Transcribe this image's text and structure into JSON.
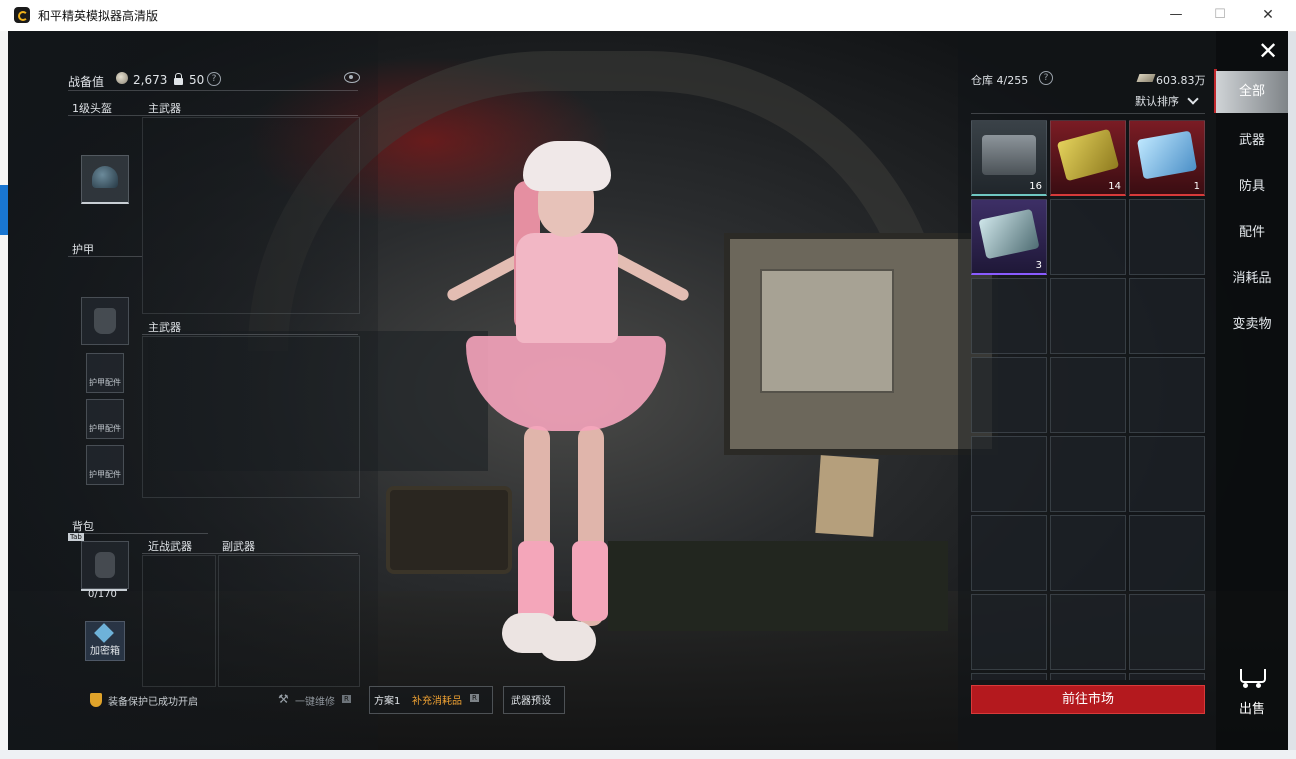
{
  "window": {
    "title": "和平精英模拟器高清版",
    "minimize": "—",
    "maximize": "☐",
    "close": "✕"
  },
  "loadout": {
    "gear_value_label": "战备值",
    "gear_value": "2,673",
    "lock_value": "50",
    "helmet_label": "1级头盔",
    "primary_weapon_1_label": "主武器",
    "armor_label": "护甲",
    "primary_weapon_2_label": "主武器",
    "armor_attachment_label": "护甲配件",
    "backpack_label": "背包",
    "backpack_tab": "Tab",
    "backpack_capacity": "0/170",
    "melee_label": "近战武器",
    "secondary_label": "副武器",
    "crate_label": "加密箱",
    "help_glyph": "?"
  },
  "bottom_bar": {
    "protection_text": "装备保护已成功开启",
    "repair_icon": "⚒",
    "repair_text": "一键维修",
    "repair_badge": "R",
    "plan_text": "方案1",
    "supply_text": "补充消耗品",
    "supply_badge": "R",
    "preset_text": "武器预设"
  },
  "warehouse": {
    "label": "仓库 4/255",
    "cash": "603.83万",
    "sort_label": "默认排序",
    "items": [
      {
        "name": "ammo-box",
        "count": "16",
        "rarity": "grey"
      },
      {
        "name": "gold-card",
        "count": "14",
        "rarity": "red"
      },
      {
        "name": "ice-card",
        "count": "1",
        "rarity": "red"
      },
      {
        "name": "ticket",
        "count": "3",
        "rarity": "purple"
      }
    ],
    "market_button": "前往市场"
  },
  "categories": {
    "close": "✕",
    "items": [
      "全部",
      "武器",
      "防具",
      "配件",
      "消耗品",
      "变卖物"
    ],
    "sell_label": "出售"
  },
  "colors": {
    "accent_red": "#b4191e",
    "rarity_red": "#d63a3a",
    "rarity_purple": "#8a5bff",
    "rarity_grey": "#6fc7c2",
    "supply_orange": "#f0a233"
  }
}
